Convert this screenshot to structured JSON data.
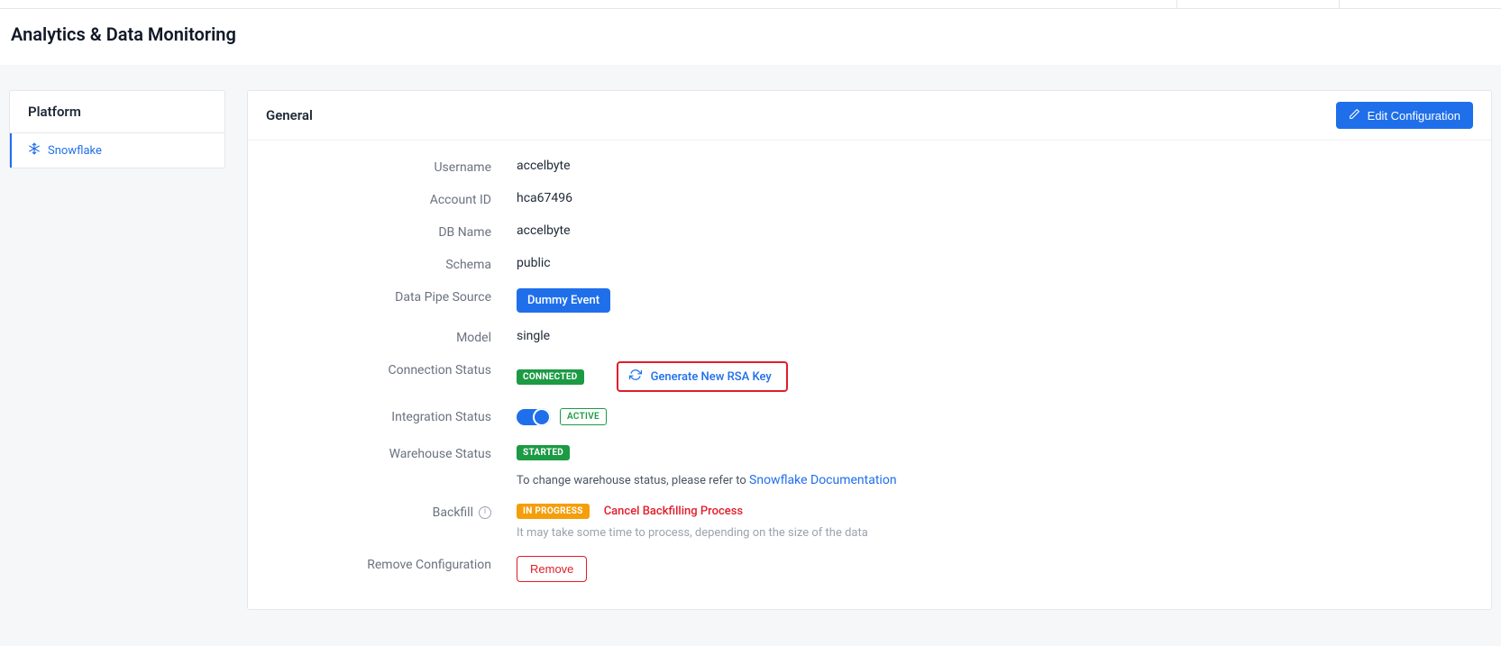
{
  "page": {
    "title": "Analytics & Data Monitoring"
  },
  "sidebar": {
    "header": "Platform",
    "items": [
      {
        "label": "Snowflake"
      }
    ]
  },
  "panel": {
    "section_title": "General",
    "edit_label": "Edit Configuration",
    "fields": {
      "username": {
        "label": "Username",
        "value": "accelbyte"
      },
      "account_id": {
        "label": "Account ID",
        "value": "hca67496"
      },
      "db_name": {
        "label": "DB Name",
        "value": "accelbyte"
      },
      "schema": {
        "label": "Schema",
        "value": "public"
      },
      "data_pipe_source": {
        "label": "Data Pipe Source",
        "chip": "Dummy Event"
      },
      "model": {
        "label": "Model",
        "value": "single"
      },
      "connection_status": {
        "label": "Connection Status",
        "badge": "CONNECTED",
        "generate_rsa_label": "Generate New RSA Key"
      },
      "integration_status": {
        "label": "Integration Status",
        "badge": "ACTIVE"
      },
      "warehouse_status": {
        "label": "Warehouse Status",
        "badge": "STARTED",
        "help_prefix": "To change warehouse status, please refer to ",
        "help_link": "Snowflake Documentation"
      },
      "backfill": {
        "label": "Backfill",
        "badge": "IN PROGRESS",
        "cancel_label": "Cancel Backfilling Process",
        "hint": "It may take some time to process, depending on the size of the data"
      },
      "remove_configuration": {
        "label": "Remove Configuration",
        "button": "Remove"
      }
    }
  }
}
